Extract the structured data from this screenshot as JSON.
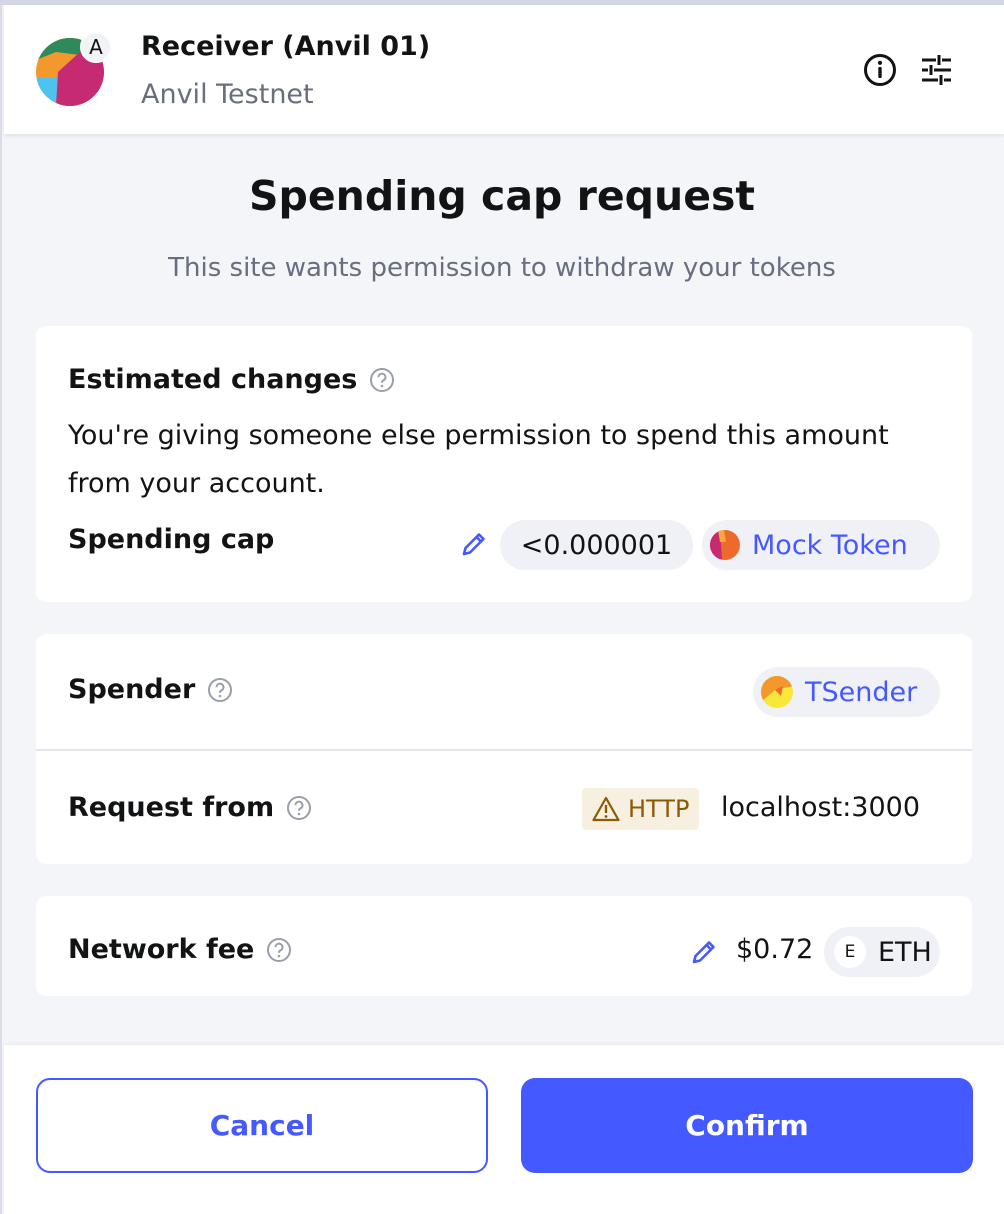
{
  "header": {
    "account_name": "Receiver (Anvil 01)",
    "network_name": "Anvil Testnet",
    "network_badge": "A"
  },
  "title": "Spending cap request",
  "subtitle": "This site wants permission to withdraw your tokens",
  "estimated_changes": {
    "label": "Estimated changes",
    "description": "You're giving someone else permission to spend this amount from your account.",
    "spending_cap_label": "Spending cap",
    "spending_cap_value": "<0.000001",
    "token_name": "Mock Token"
  },
  "spender": {
    "label": "Spender",
    "name": "TSender"
  },
  "request_from": {
    "label": "Request from",
    "protocol_badge": "HTTP",
    "origin": "localhost:3000"
  },
  "network_fee": {
    "label": "Network fee",
    "fee": "$0.72",
    "currency_letter": "E",
    "currency": "ETH"
  },
  "footer": {
    "cancel_label": "Cancel",
    "confirm_label": "Confirm"
  },
  "colors": {
    "primary": "#4459ff",
    "text_muted": "#686e7d",
    "warning_bg": "#f7efe0",
    "warning_text": "#8c5a04"
  },
  "icons": [
    "info-icon",
    "settings-sliders-icon",
    "question-icon",
    "pencil-icon",
    "warning-icon"
  ]
}
